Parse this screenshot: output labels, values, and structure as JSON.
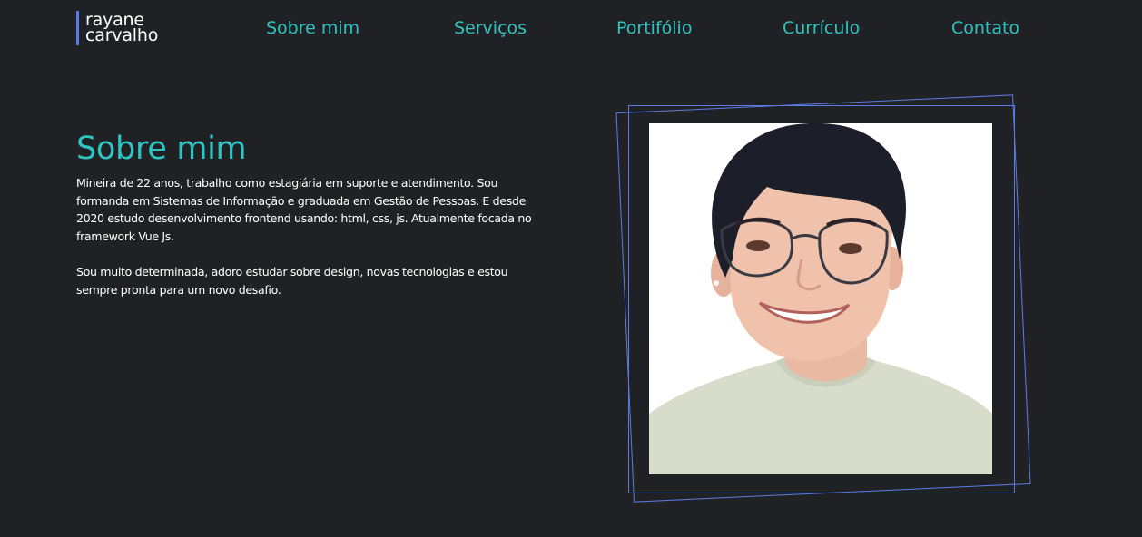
{
  "header": {
    "logo_line1": "rayane",
    "logo_line2": "carvalho",
    "nav": [
      {
        "label": "Sobre mim"
      },
      {
        "label": "Serviços"
      },
      {
        "label": "Portifólio"
      },
      {
        "label": "Currículo"
      },
      {
        "label": "Contato"
      }
    ]
  },
  "about": {
    "title": "Sobre mim",
    "paragraph1": "Mineira de 22 anos, trabalho como estagiária em suporte e atendimento. Sou formanda em Sistemas de Informação e graduada em Gestão de Pessoas. E desde 2020 estudo desenvolvimento frontend usando: html, css, js. Atualmente focada no framework Vue Js.",
    "paragraph2": "Sou muito determinada, adoro estudar sobre design, novas tecnologias e estou sempre pronta para um novo desafio."
  },
  "colors": {
    "background": "#202124",
    "accent": "#2ec4c2",
    "frame": "#5b7be6",
    "text": "#ffffff"
  }
}
